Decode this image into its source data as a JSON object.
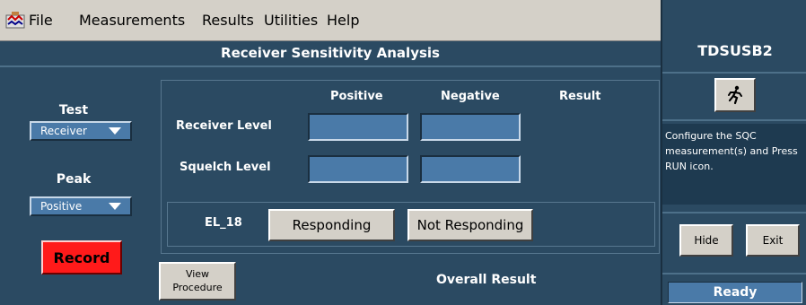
{
  "menu": {
    "app_icon": "app-icon",
    "items": [
      {
        "label": "File"
      },
      {
        "label": "Measurements"
      },
      {
        "label": "Results"
      },
      {
        "label": "Utilities"
      },
      {
        "label": "Help"
      }
    ]
  },
  "main": {
    "title": "Receiver Sensitivity Analysis",
    "test": {
      "label": "Test",
      "selected": "Receiver"
    },
    "peak": {
      "label": "Peak",
      "selected": "Positive"
    },
    "record_label": "Record",
    "columns": [
      "Positive",
      "Negative",
      "Result"
    ],
    "rows": [
      {
        "label": "Receiver Level",
        "positive": "",
        "negative": ""
      },
      {
        "label": "Squelch Level",
        "positive": "",
        "negative": ""
      }
    ],
    "el": {
      "label": "EL_18",
      "responding_label": "Responding",
      "not_responding_label": "Not Responding"
    },
    "view_procedure": {
      "line1": "View",
      "line2": "Procedure"
    },
    "overall_result_label": "Overall Result"
  },
  "right_panel": {
    "brand": "TDSUSB2",
    "run_icon": "running-man-icon",
    "message": "Configure the SQC measurement(s) and Press RUN icon.",
    "hide_label": "Hide",
    "exit_label": "Exit",
    "status": "Ready"
  },
  "colors": {
    "panel_bg": "#2b4a62",
    "field_bg": "#4a7aa8",
    "record_red": "#ff1a1a",
    "menubar_gray": "#d4d0c8"
  }
}
